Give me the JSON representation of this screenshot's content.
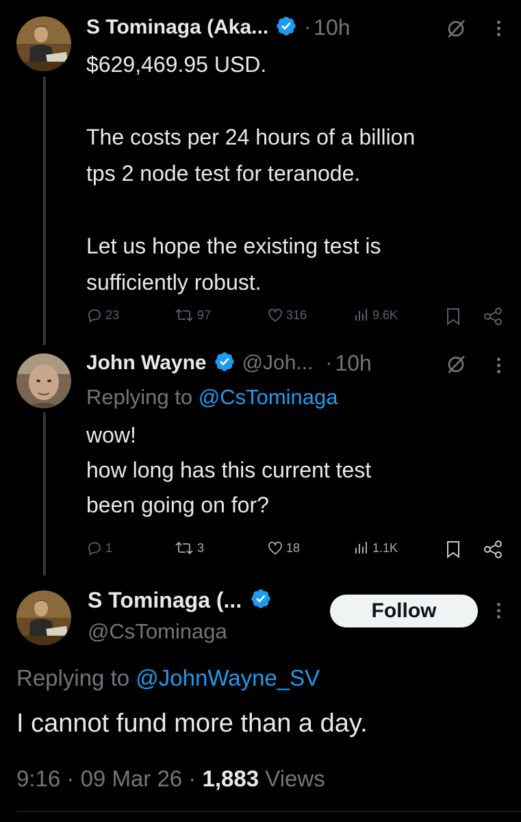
{
  "tweet1": {
    "author_name": "S Tominaga (Aka...",
    "time": "10h",
    "lines": [
      "$629,469.95 USD.",
      "",
      "The costs per 24 hours of a  billion",
      "tps 2 node test for teranode.",
      "",
      "Let us hope the existing test is",
      "sufficiently robust."
    ],
    "replies": "23",
    "reposts": "97",
    "likes": "316",
    "views": "9.6K"
  },
  "tweet2": {
    "author_name": "John Wayne",
    "handle": "@Joh...",
    "time": "10h",
    "replying_prefix": "Replying to ",
    "replying_handle": "@CsTominaga",
    "lines": [
      "wow!",
      "how long has this current test",
      "been going on for?"
    ],
    "replies": "1",
    "reposts": "3",
    "likes": "18",
    "views": "1.1K"
  },
  "main_tweet": {
    "author_name": "S Tominaga (...",
    "handle": "@CsTominaga",
    "follow_label": "Follow",
    "replying_prefix": "Replying to ",
    "replying_handle": "@JohnWayne_SV",
    "text": "I cannot fund more than a day.",
    "time": "9:16",
    "date": "09 Mar 26",
    "views_count": "1,883",
    "views_label": "Views"
  },
  "separator": "·",
  "icons": {
    "verified": "verified-badge-icon",
    "grok": "grok-icon",
    "more": "more-vertical-icon",
    "reply": "reply-icon",
    "repost": "repost-icon",
    "like": "like-icon",
    "views": "views-icon",
    "bookmark": "bookmark-icon",
    "share": "share-icon"
  },
  "colors": {
    "background": "#000000",
    "text": "#e7e9ea",
    "muted": "#71767b",
    "link": "#1d9bf0",
    "verified": "#1d9bf0"
  }
}
